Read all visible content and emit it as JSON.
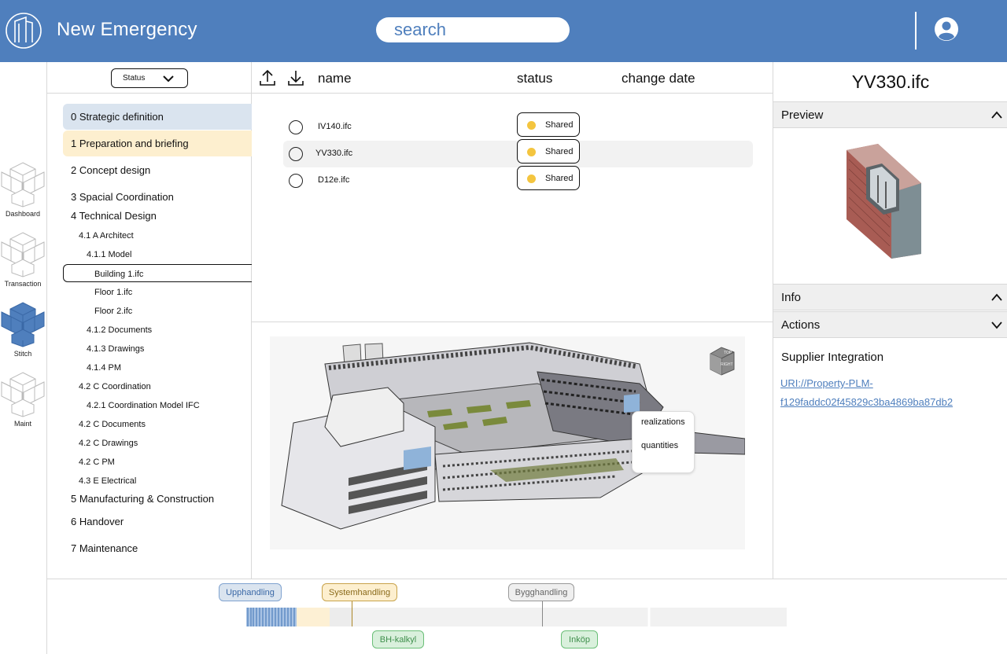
{
  "app": {
    "title": "New Emergency"
  },
  "header": {
    "search_placeholder": "search"
  },
  "rail": [
    {
      "label": "Dashboard",
      "icon": "cube-outline-icon",
      "active": false
    },
    {
      "label": "Transaction",
      "icon": "cube-outline-icon",
      "active": false
    },
    {
      "label": "Stitch",
      "icon": "cube-filled-icon",
      "active": true
    },
    {
      "label": "Maint",
      "icon": "cube-outline-icon",
      "active": false
    }
  ],
  "filter": {
    "label": "Status"
  },
  "tree": [
    "0 Strategic definition",
    "1 Preparation and briefing",
    "2 Concept design",
    "3 Spacial Coordination",
    "4 Technical Design",
    "4.1  A Architect",
    "4.1.1 Model",
    "Building 1.ifc",
    "Floor 1.ifc",
    "Floor 2.ifc",
    "4.1.2 Documents",
    "4.1.3 Drawings",
    "4.1.4 PM",
    "4.2 C Coordination",
    "4.2.1 Coordination Model IFC",
    "4.2 C Documents",
    "4.2 C Drawings",
    "4.2 C PM",
    "4.3 E Electrical",
    "5 Manufacturing & Construction",
    "6 Handover",
    "7 Maintenance"
  ],
  "files": {
    "columns": {
      "name": "name",
      "status": "status",
      "change_date": "change date"
    },
    "rows": [
      {
        "name": "IV140.ifc",
        "status": "Shared",
        "selected": false
      },
      {
        "name": "YV330.ifc",
        "status": "Shared",
        "selected": true
      },
      {
        "name": "D12e.ifc",
        "status": "Shared",
        "selected": false
      }
    ]
  },
  "viewer": {
    "cube_labels": [
      "TOP",
      "RIGHT"
    ],
    "context_menu": [
      "realizations",
      "quantities"
    ]
  },
  "details": {
    "title": "YV330.ifc",
    "preview_label": "Preview",
    "info_label": "Info",
    "actions_label": "Actions",
    "supplier_label": "Supplier Integration",
    "uri_line1": "URI://Property-PLM-",
    "uri_line2": "f129faddc02f45829c3ba4869ba87db2"
  },
  "timeline": {
    "upper_tags": [
      "Upphandling",
      "Systemhandling",
      "Bygghandling"
    ],
    "lower_tags": [
      "BH-kalkyl",
      "Inköp"
    ]
  },
  "colors": {
    "brand": "#4f7fbd",
    "status_shared": "#f4c53f",
    "highlight_blue": "#dae4ef",
    "highlight_yellow": "#fdefcf"
  }
}
